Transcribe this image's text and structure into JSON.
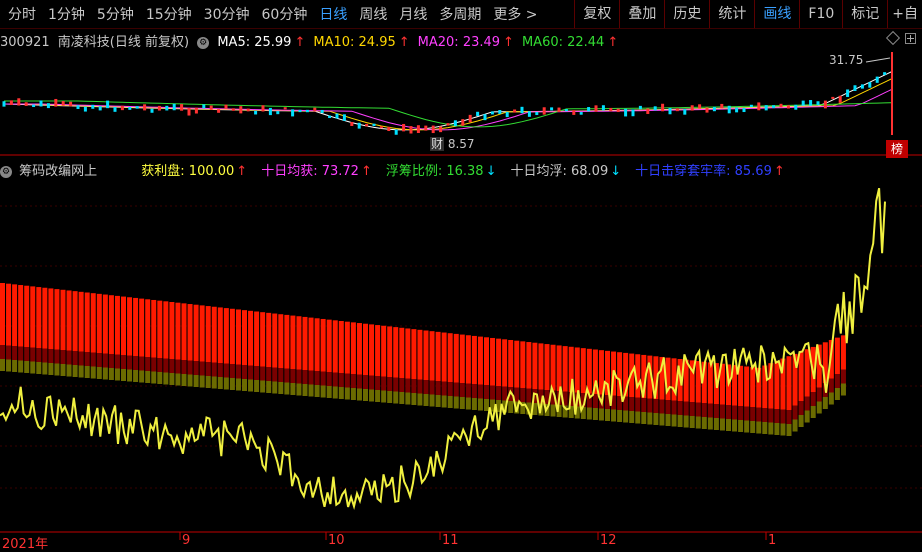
{
  "toolbar": {
    "periods": [
      "分时",
      "1分钟",
      "5分钟",
      "15分钟",
      "30分钟",
      "60分钟",
      "日线",
      "周线",
      "月线",
      "多周期",
      "更多 >"
    ],
    "active_period": "日线",
    "buttons": [
      "复权",
      "叠加",
      "历史",
      "统计",
      "画线",
      "F10",
      "标记",
      "+自"
    ],
    "active_button": "画线"
  },
  "stock": {
    "code": "300921",
    "name": "南凌科技(日线 前复权)",
    "ma": [
      {
        "label": "MA5: 25.99",
        "color": "#ffffff",
        "arrow": "↑"
      },
      {
        "label": "MA10: 24.95",
        "color": "#ffd700",
        "arrow": "↑"
      },
      {
        "label": "MA20: 23.49",
        "color": "#ff40ff",
        "arrow": "↑"
      },
      {
        "label": "MA60: 22.44",
        "color": "#33dd33",
        "arrow": "↑"
      }
    ],
    "high_label": "31.75",
    "low_label": "8.57",
    "cai_label": "财",
    "bang_label": "榜"
  },
  "indicator": {
    "name": "筹码改编网上",
    "items": [
      {
        "label": "获利盘: 100.00",
        "color": "#ffff40",
        "arrow": "↑",
        "arrow_color": "#ff3232"
      },
      {
        "label": "十日均获: 73.72",
        "color": "#ff40ff",
        "arrow": "↑",
        "arrow_color": "#ff3232"
      },
      {
        "label": "浮筹比例: 16.38",
        "color": "#33dd33",
        "arrow": "↓",
        "arrow_color": "#00e0ff"
      },
      {
        "label": "十日均浮: 68.09",
        "color": "#c8c8c8",
        "arrow": "↓",
        "arrow_color": "#00e0ff"
      },
      {
        "label": "十日击穿套牢率: 85.69",
        "color": "#3040ff",
        "arrow": "↑",
        "arrow_color": "#ff3232"
      }
    ]
  },
  "x_axis": [
    "2021年",
    "9",
    "10",
    "11",
    "12",
    "1"
  ],
  "colors": {
    "axis": "#c00000",
    "chip_red": "#ff1a00",
    "chip_dark": "#7a0000",
    "chip_olive": "#6b6b00",
    "line": "#f0f040"
  }
}
